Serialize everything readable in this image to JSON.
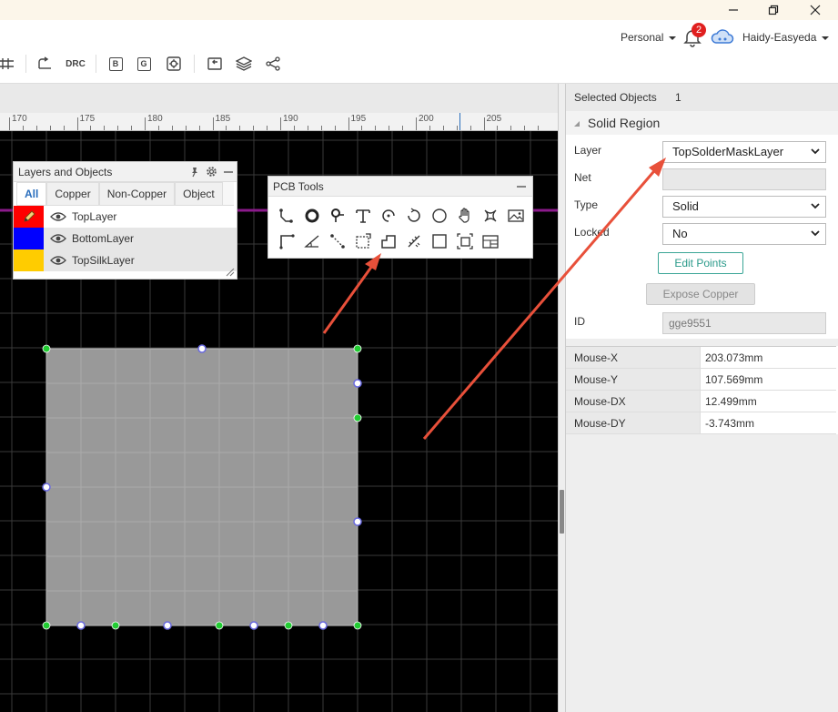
{
  "header": {
    "workspace_label": "Personal",
    "notification_count": "2",
    "username": "Haidy-Easyeda",
    "drc_label": "DRC",
    "toolbar_letters": [
      "B",
      "G"
    ]
  },
  "ruler": {
    "labels": [
      "170",
      "175",
      "180",
      "185",
      "190",
      "195",
      "200",
      "205"
    ]
  },
  "layers_panel": {
    "title": "Layers and Objects",
    "tabs": [
      "All",
      "Copper",
      "Non-Copper",
      "Object"
    ],
    "active_tab": "All",
    "layers": [
      {
        "name": "TopLayer",
        "color": "#ff0000"
      },
      {
        "name": "BottomLayer",
        "color": "#0000ff"
      },
      {
        "name": "TopSilkLayer",
        "color": "#ffcc00"
      }
    ]
  },
  "pcb_tools": {
    "title": "PCB Tools"
  },
  "properties": {
    "selected_label": "Selected Objects",
    "selected_count": "1",
    "section_title": "Solid Region",
    "layer_label": "Layer",
    "layer_value": "TopSolderMaskLayer",
    "net_label": "Net",
    "net_value": "",
    "type_label": "Type",
    "type_value": "Solid",
    "locked_label": "Locked",
    "locked_value": "No",
    "edit_points_label": "Edit Points",
    "expose_copper_label": "Expose Copper",
    "id_label": "ID",
    "id_value": "gge9551"
  },
  "mouse": {
    "rows": [
      {
        "key": "Mouse-X",
        "value": "203.073mm"
      },
      {
        "key": "Mouse-Y",
        "value": "107.569mm"
      },
      {
        "key": "Mouse-DX",
        "value": "12.499mm"
      },
      {
        "key": "Mouse-DY",
        "value": "-3.743mm"
      }
    ]
  },
  "colors": {
    "accent": "#2a6ebd",
    "canvas_bg": "#000000",
    "grid": "#3a3a3a",
    "region_fill": "#999999",
    "vertex_green": "#22cc33",
    "vertex_blue": "#6a6ae0",
    "annotation_arrow": "#e8503a",
    "track_purple": "#8b1a8b"
  }
}
